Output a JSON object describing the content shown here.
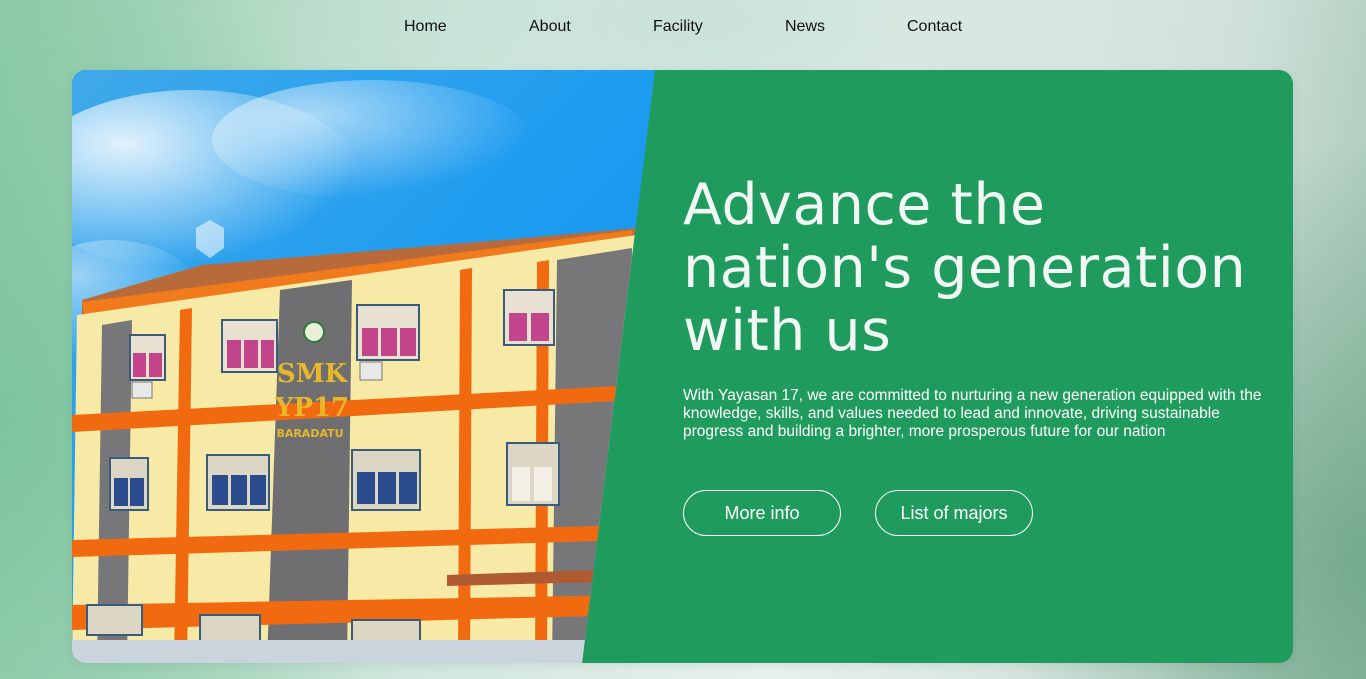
{
  "nav": {
    "items": [
      {
        "label": "Home"
      },
      {
        "label": "About"
      },
      {
        "label": "Facility"
      },
      {
        "label": "News"
      },
      {
        "label": "Contact"
      }
    ]
  },
  "hero": {
    "photo_sign": {
      "line1": "SMK",
      "line2": "YP17",
      "line3": "BARADATU"
    },
    "headline": "Advance the nation's generation with us",
    "description": "With Yayasan 17, we are committed to nurturing a new generation equipped with the knowledge, skills, and values needed to lead and innovate, driving sustainable progress and building a brighter, more prosperous future for our nation",
    "buttons": {
      "more_info": "More info",
      "list_of_majors": "List of majors"
    }
  },
  "colors": {
    "accent_green": "#1f9c5d",
    "text_light": "#ffffff",
    "nav_text": "#111111"
  }
}
